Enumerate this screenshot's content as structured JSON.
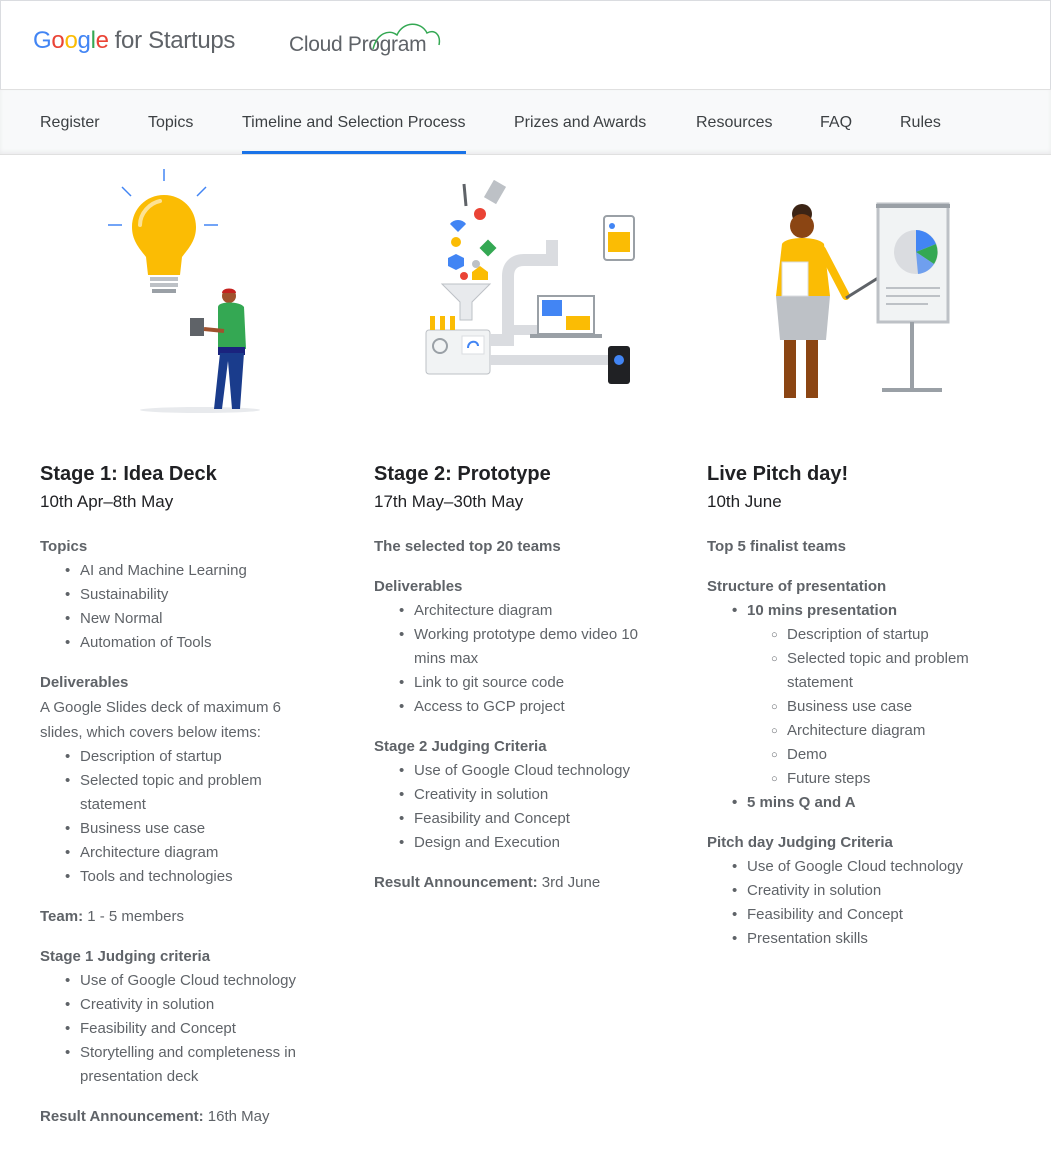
{
  "header": {
    "logo_google": "Google",
    "logo_startups": "for Startups",
    "logo_cloud": "Cloud Program"
  },
  "nav": {
    "tabs": [
      {
        "label": "Register"
      },
      {
        "label": "Topics"
      },
      {
        "label": "Timeline and Selection Process"
      },
      {
        "label": "Prizes and Awards"
      },
      {
        "label": "Resources"
      },
      {
        "label": "FAQ"
      },
      {
        "label": "Rules"
      }
    ],
    "active_index": 2,
    "active_color": "#1a73e8"
  },
  "stage1": {
    "title": "Stage 1: Idea Deck",
    "date": "10th Apr–8th May",
    "topics_heading": "Topics",
    "topics": [
      "AI and Machine Learning",
      "Sustainability",
      "New Normal",
      "Automation of Tools"
    ],
    "deliverables_heading": "Deliverables",
    "deliverables_text": "A Google Slides deck of maximum 6 slides, which covers below items:",
    "deliverables": [
      "Description of startup",
      "Selected topic and problem statement",
      "Business use case",
      "Architecture diagram",
      "Tools and technologies"
    ],
    "team_label": "Team:",
    "team_value": "1 - 5 members",
    "judging_heading": "Stage 1 Judging criteria",
    "judging": [
      "Use of Google Cloud technology",
      "Creativity in solution",
      "Feasibility and Concept",
      "Storytelling and completeness in presentation deck"
    ],
    "result_label": "Result Announcement:",
    "result_value": "16th May"
  },
  "stage2": {
    "title": "Stage 2: Prototype",
    "date": "17th May–30th May",
    "selected_heading": "The selected top 20 teams",
    "deliverables_heading": "Deliverables",
    "deliverables": [
      "Architecture diagram",
      "Working prototype demo video 10 mins max",
      "Link to git source code",
      "Access to GCP project"
    ],
    "judging_heading": "Stage 2 Judging Criteria",
    "judging": [
      "Use of Google Cloud technology",
      "Creativity in solution",
      "Feasibility and Concept",
      "Design and Execution"
    ],
    "result_label": "Result Announcement:",
    "result_value": "3rd June"
  },
  "stage3": {
    "title": "Live Pitch day!",
    "date": "10th June",
    "finalists_heading": "Top 5 finalist teams",
    "structure_heading": "Structure of presentation",
    "presentation_label": "10 mins presentation",
    "presentation_items": [
      "Description of startup",
      "Selected topic and problem statement",
      "Business use case",
      "Architecture diagram",
      "Demo",
      "Future steps"
    ],
    "qa_label": "5 mins Q and A",
    "judging_heading": "Pitch day Judging Criteria",
    "judging": [
      "Use of Google Cloud technology",
      "Creativity in solution",
      "Feasibility and Concept",
      "Presentation skills"
    ]
  }
}
